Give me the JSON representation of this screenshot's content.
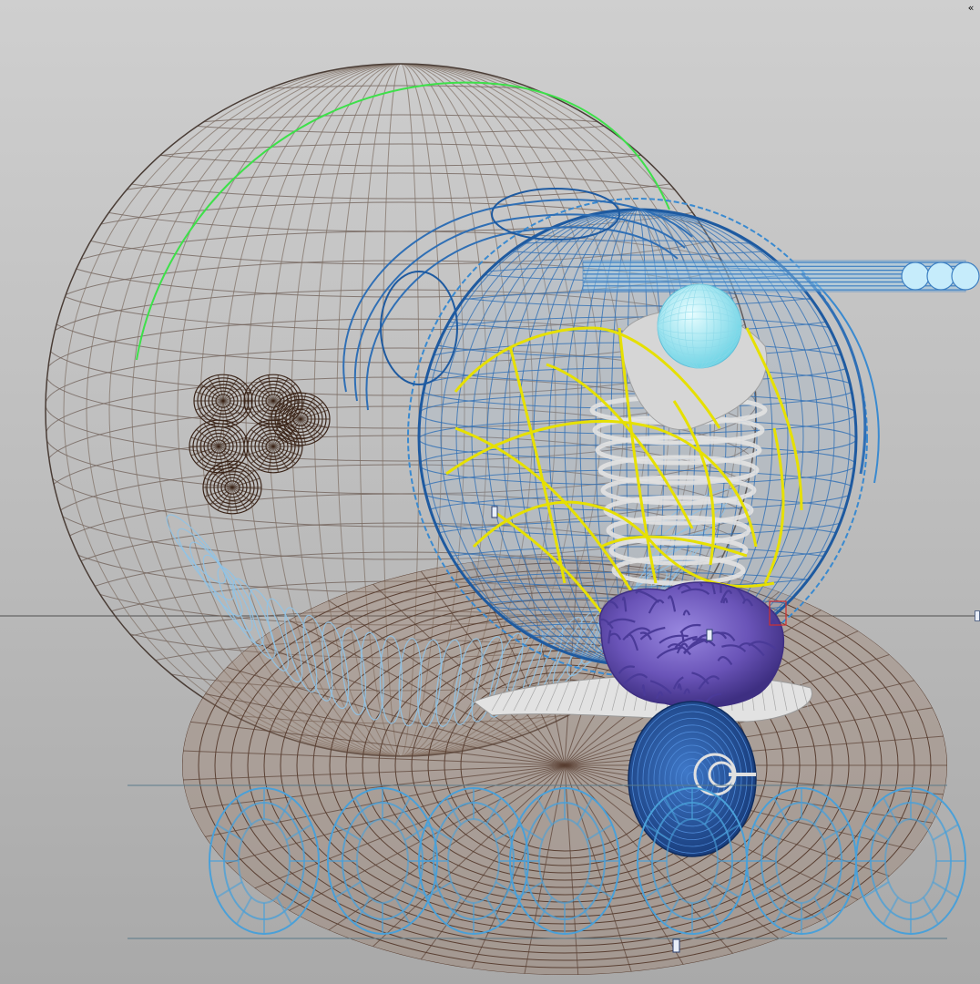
{
  "viewport": {
    "corner_button": "«",
    "colors": {
      "background_top": "#cfcfcf",
      "background_bottom": "#a9a9a9",
      "horizon_line": "#505050",
      "shell_wire": "#6e5e55",
      "shell_wire_light": "#8a7d72",
      "outer_wire_blue": "#2f6fb5",
      "inner_wire_yellow": "#e6e000",
      "spring_light_blue": "#8fc3e6",
      "sphere_cyan": "#a6ecf4",
      "brain_purple": "#6a54b8",
      "rotor_dark_blue": "#1f4f9e",
      "brown_shell": "#7a5a45",
      "gear_dark_brown": "#3a2418",
      "green_highlight": "#3ee04a",
      "grey_solid": "#d8d8d8"
    }
  }
}
